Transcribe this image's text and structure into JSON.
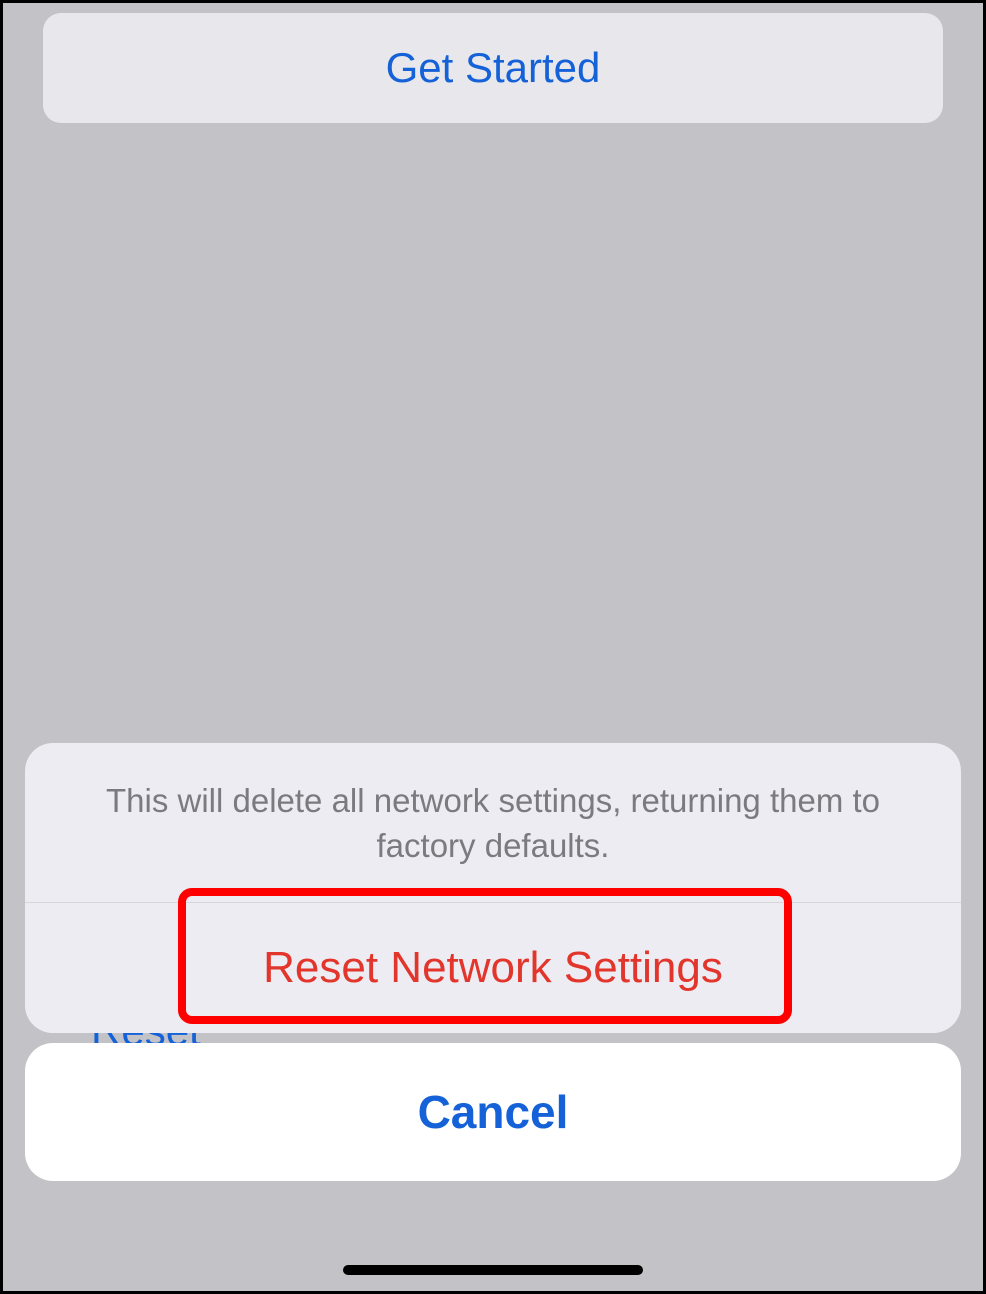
{
  "header": {
    "get_started_label": "Get Started"
  },
  "behind": {
    "reset_label": "Reset"
  },
  "sheet": {
    "message": "This will delete all network settings, returning them to factory defaults.",
    "reset_action_label": "Reset Network Settings",
    "cancel_label": "Cancel"
  }
}
